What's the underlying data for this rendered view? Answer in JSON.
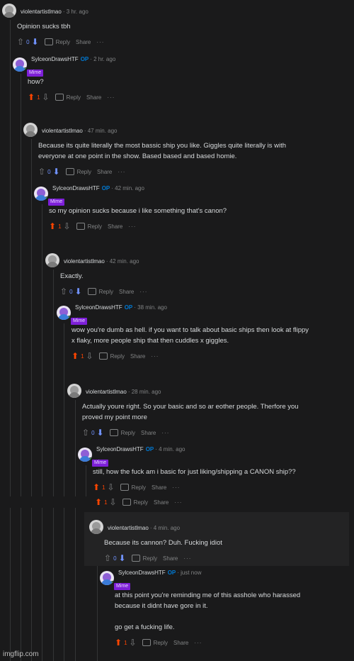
{
  "comments": [
    {
      "user": "violentartistlmao",
      "op": false,
      "time": "3 hr. ago",
      "flair": "",
      "body": [
        "Opinion sucks tbh"
      ],
      "votes": "0",
      "vote": "down",
      "reply": "Reply",
      "share": "Share",
      "more": "···"
    },
    {
      "user": "SylceonDrawsHTF",
      "op": true,
      "op_label": "OP",
      "time": "2 hr. ago",
      "flair": "Mime",
      "body": [
        "how?"
      ],
      "votes": "1",
      "vote": "up",
      "reply": "Reply",
      "share": "Share",
      "more": "···"
    },
    {
      "user": "violentartistlmao",
      "op": false,
      "time": "47 min. ago",
      "flair": "",
      "body": [
        "Because its quite literally the most bassic ship you like. Giggles quite literally is with",
        "everyone at one point in the show. Based based and based homie."
      ],
      "votes": "0",
      "vote": "down",
      "reply": "Reply",
      "share": "Share",
      "more": "···"
    },
    {
      "user": "SylceonDrawsHTF",
      "op": true,
      "op_label": "OP",
      "time": "42 min. ago",
      "flair": "Mime",
      "body": [
        "so my opinion sucks because i like something that's canon?"
      ],
      "votes": "1",
      "vote": "up",
      "reply": "Reply",
      "share": "Share",
      "more": "···"
    },
    {
      "user": "violentartistlmao",
      "op": false,
      "time": "42 min. ago",
      "flair": "",
      "body": [
        "Exactly."
      ],
      "votes": "0",
      "vote": "down",
      "reply": "Reply",
      "share": "Share",
      "more": "···"
    },
    {
      "user": "SylceonDrawsHTF",
      "op": true,
      "op_label": "OP",
      "time": "38 min. ago",
      "flair": "Mime",
      "body": [
        "wow you're dumb as hell. if you want to talk about basic ships then look at flippy",
        "x flaky, more people ship that then cuddles x giggles."
      ],
      "votes": "1",
      "vote": "up",
      "reply": "Reply",
      "share": "Share",
      "more": "···"
    },
    {
      "user": "violentartistlmao",
      "op": false,
      "time": "28 min. ago",
      "flair": "",
      "body": [
        "Actually youre right. So your basic and so ar eother people. Therfore you",
        "proved my point more"
      ],
      "votes": "0",
      "vote": "down",
      "reply": "Reply",
      "share": "Share",
      "more": "···"
    },
    {
      "user": "SylceonDrawsHTF",
      "op": true,
      "op_label": "OP",
      "time": "4 min. ago",
      "flair": "Mime",
      "body": [
        "still, how the fuck am i basic for just liking/shipping a CANON ship??"
      ],
      "votes": "1",
      "vote": "up",
      "reply": "Reply",
      "share": "Share",
      "more": "···"
    },
    {
      "user": "violentartistlmao",
      "op": false,
      "time": "4 min. ago",
      "flair": "",
      "body": [
        "Because its cannon? Duh. Fucking idiot"
      ],
      "votes": "0",
      "vote": "down",
      "reply": "Reply",
      "share": "Share",
      "more": "···"
    },
    {
      "user": "SylceonDrawsHTF",
      "op": true,
      "op_label": "OP",
      "time": "just now",
      "flair": "Mime",
      "body": [
        "at this point you're reminding me of this asshole who harassed",
        "because it didnt have gore in it.",
        "",
        "go get a fucking life."
      ],
      "votes": "1",
      "vote": "up",
      "reply": "Reply",
      "share": "Share",
      "more": "···"
    }
  ],
  "overlap_row": {
    "votes_a": "1",
    "votes_b": "1",
    "reply": "Reply",
    "share": "Share",
    "more": "···"
  },
  "watermark": "imgflip.com"
}
